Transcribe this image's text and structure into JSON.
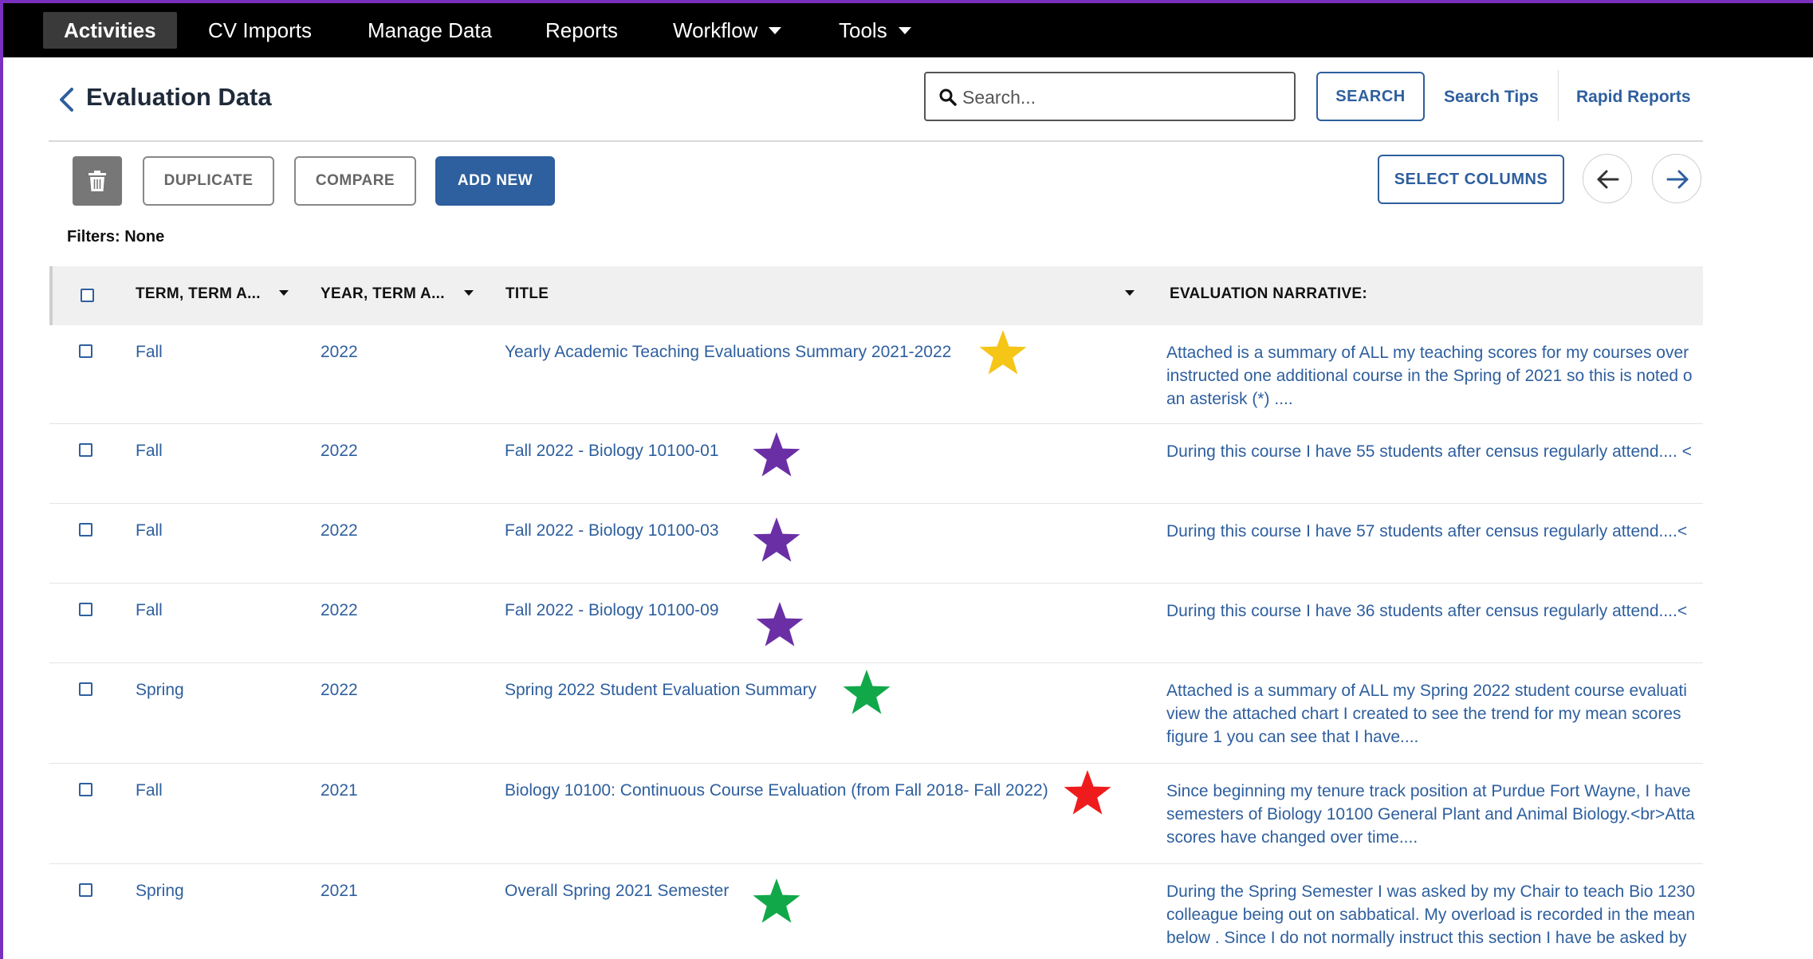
{
  "nav": {
    "items": [
      {
        "label": "Activities",
        "active": true
      },
      {
        "label": "CV Imports"
      },
      {
        "label": "Manage Data"
      },
      {
        "label": "Reports"
      },
      {
        "label": "Workflow",
        "dropdown": true
      },
      {
        "label": "Tools",
        "dropdown": true
      }
    ]
  },
  "header": {
    "title": "Evaluation Data",
    "search_placeholder": "Search...",
    "search_button": "SEARCH",
    "search_tips": "Search Tips",
    "rapid_reports": "Rapid Reports"
  },
  "toolbar": {
    "duplicate": "DUPLICATE",
    "compare": "COMPARE",
    "add_new": "ADD NEW",
    "select_columns": "SELECT COLUMNS"
  },
  "filters": "Filters: None",
  "table": {
    "columns": [
      "TERM, TERM A...",
      "YEAR, TERM A...",
      "TITLE",
      "EVALUATION NARRATIVE:"
    ],
    "rows": [
      {
        "term": "Fall",
        "year": "2022",
        "title": "Yearly Academic Teaching Evaluations Summary 2021-2022",
        "star_color": "#f5c518",
        "narrative": [
          "Attached is a summary of ALL my teaching scores for my courses over",
          "instructed one additional course in the Spring of 2021 so this is noted o",
          "an asterisk (*) ...."
        ]
      },
      {
        "term": "Fall",
        "year": "2022",
        "title": "Fall 2022 - Biology 10100-01",
        "star_color": "#6b2fa5",
        "narrative": [
          "During this course I have 55 students after census regularly attend.... <"
        ]
      },
      {
        "term": "Fall",
        "year": "2022",
        "title": "Fall 2022 - Biology 10100-03",
        "star_color": "#6b2fa5",
        "narrative": [
          "During this course I have 57 students after census regularly attend....<"
        ]
      },
      {
        "term": "Fall",
        "year": "2022",
        "title": "Fall 2022 - Biology 10100-09",
        "star_color": "#6b2fa5",
        "narrative": [
          "During this course I have 36 students after census regularly attend....<"
        ]
      },
      {
        "term": "Spring",
        "year": "2022",
        "title": "Spring 2022 Student Evaluation Summary",
        "star_color": "#11a84a",
        "narrative": [
          "Attached is a summary of ALL my Spring 2022 student course evaluati",
          "view the attached chart I created to see the trend for my mean scores",
          "figure 1 you can see that I have...."
        ]
      },
      {
        "term": "Fall",
        "year": "2021",
        "title": "Biology 10100: Continuous Course Evaluation (from Fall 2018- Fall 2022)",
        "star_color": "#ee1c1c",
        "narrative": [
          "Since beginning my tenure track position at Purdue Fort Wayne, I have",
          "semesters of Biology 10100 General Plant and Animal Biology.<br>Atta",
          "scores have changed over time...."
        ]
      },
      {
        "term": "Spring",
        "year": "2021",
        "title": "Overall Spring 2021 Semester",
        "star_color": "#11a84a",
        "narrative": [
          "During the Spring Semester I was asked by my Chair to teach Bio 1230",
          "colleague being out on sabbatical. My overload is recorded in the mean",
          "below . Since I do not normally instruct this section I have be asked by"
        ]
      }
    ]
  },
  "colors": {
    "nav_bg": "#000000",
    "accent": "#2e5f9e",
    "frame": "#7b2fbf"
  }
}
